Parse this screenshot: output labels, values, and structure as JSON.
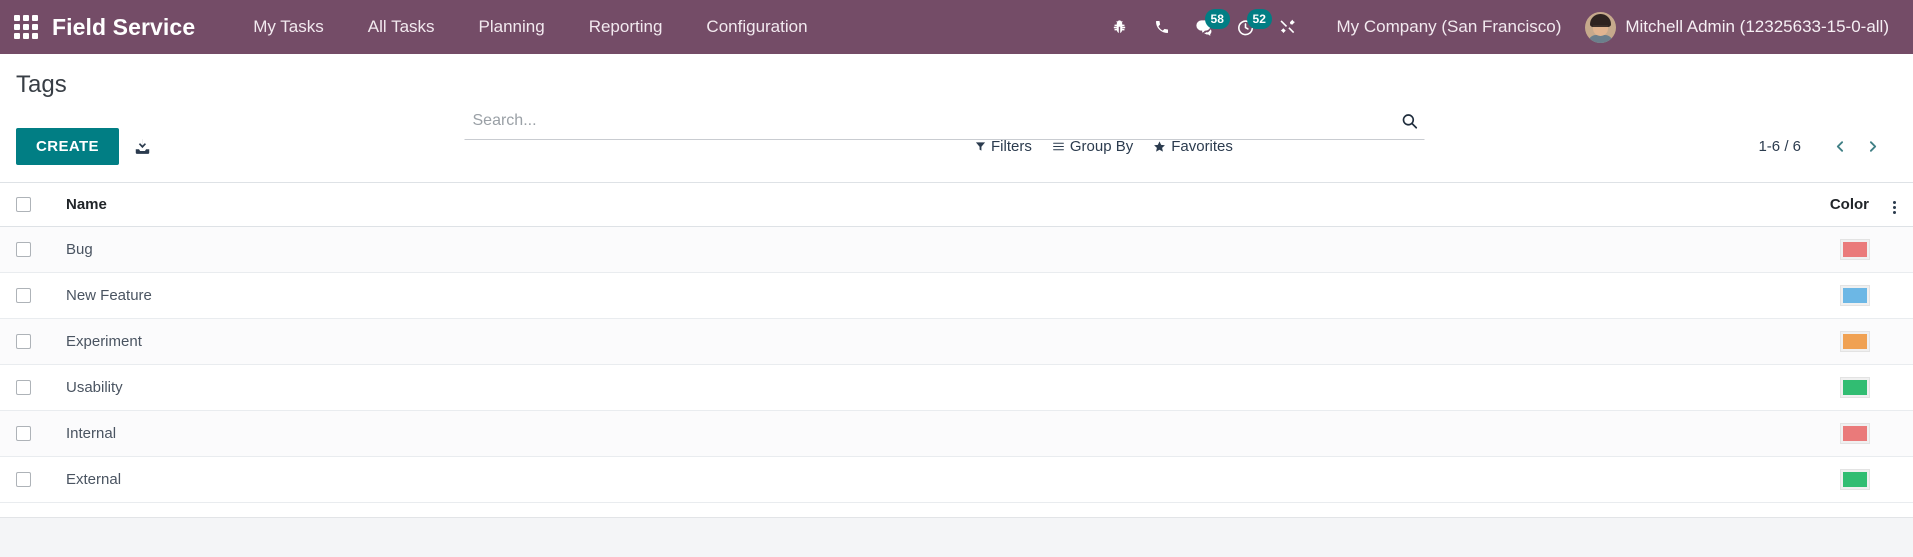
{
  "navbar": {
    "apps_icon": "apps-grid-icon",
    "brand": "Field Service",
    "menu": [
      {
        "label": "My Tasks"
      },
      {
        "label": "All Tasks"
      },
      {
        "label": "Planning"
      },
      {
        "label": "Reporting"
      },
      {
        "label": "Configuration"
      }
    ],
    "icons": [
      {
        "name": "bug-icon",
        "badge": null
      },
      {
        "name": "phone-icon",
        "badge": null
      },
      {
        "name": "messages-icon",
        "badge": "58"
      },
      {
        "name": "activities-clock-icon",
        "badge": "52"
      },
      {
        "name": "tools-wrench-icon",
        "badge": null
      }
    ],
    "company": "My Company (San Francisco)",
    "user": "Mitchell Admin (12325633-15-0-all)",
    "background_color": "#744c67",
    "badge_color": "#017e84"
  },
  "control_panel": {
    "title": "Tags",
    "create_label": "CREATE",
    "import_icon": "import-download-icon",
    "search": {
      "placeholder": "Search...",
      "value": "",
      "icon": "search-icon"
    },
    "filters": [
      {
        "label": "Filters",
        "icon": "funnel-icon"
      },
      {
        "label": "Group By",
        "icon": "list-lines-icon"
      },
      {
        "label": "Favorites",
        "icon": "star-icon"
      }
    ],
    "pager": {
      "range": "1-6 / 6",
      "prev_icon": "chevron-left-icon",
      "next_icon": "chevron-right-icon"
    },
    "create_button_color": "#017e84"
  },
  "list": {
    "columns": {
      "check": "",
      "name": "Name",
      "color": "Color",
      "options_icon": "kebab-menu-icon"
    },
    "rows": [
      {
        "name": "Bug",
        "color": "#ea7a7a"
      },
      {
        "name": "New Feature",
        "color": "#6cb7e5"
      },
      {
        "name": "Experiment",
        "color": "#f0a152"
      },
      {
        "name": "Usability",
        "color": "#31bd72"
      },
      {
        "name": "Internal",
        "color": "#ea7a7a"
      },
      {
        "name": "External",
        "color": "#31bd72"
      }
    ]
  }
}
